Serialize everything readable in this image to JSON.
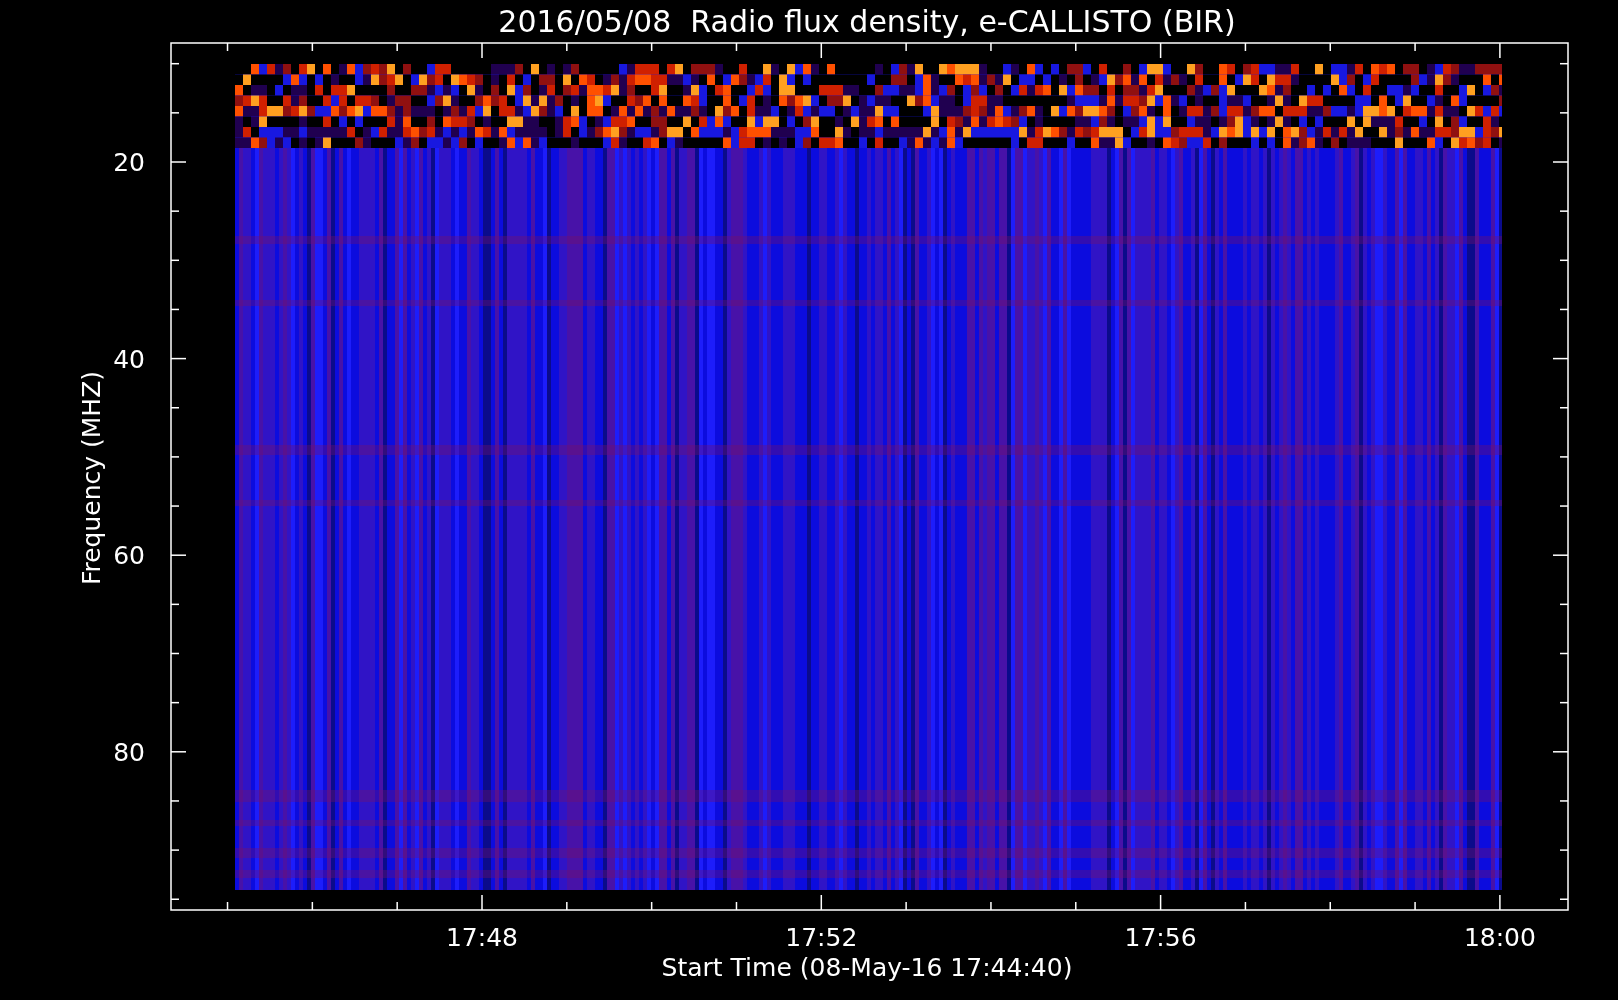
{
  "chart": {
    "title": "2016/05/08  Radio flux density, e-CALLISTO (BIR)",
    "xlabel": "Start Time (08-May-16 17:44:40)",
    "ylabel": "Frequency (MHZ)",
    "xticks": [
      "17:48",
      "17:52",
      "17:56",
      "18:00"
    ],
    "yticks": [
      "20",
      "40",
      "60",
      "80"
    ]
  }
}
